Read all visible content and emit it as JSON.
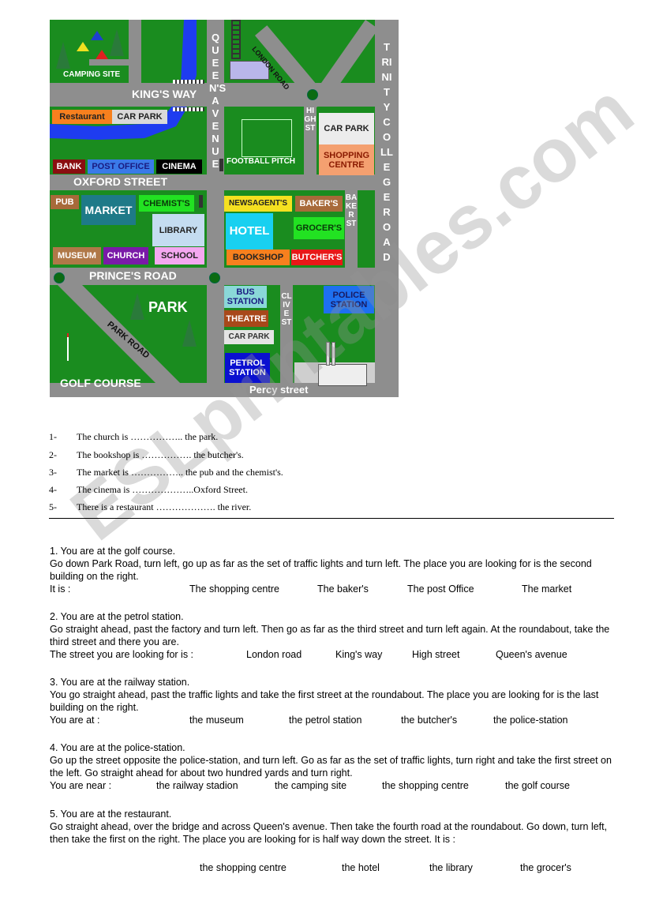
{
  "map": {
    "roads": {
      "kings_way": "KING'S WAY",
      "oxford_street": "OXFORD STREET",
      "princes_road": "PRINCE'S ROAD",
      "percy_street": "Percy street",
      "queens_avenue": "QUEEN'S AVENUE",
      "trinity_college_road": "TRINITY COLLEGE ROAD",
      "high_st": "HIGH ST",
      "baker_st": "BAKER ST",
      "clive_st": "CLIVE ST",
      "london_road": "LONDON ROAD",
      "park_road": "PARK ROAD"
    },
    "places": {
      "camping_site": "CAMPING SITE",
      "restaurant": "Restaurant",
      "car_park_1": "CAR PARK",
      "bank": "BANK",
      "post_office": "POST OFFICE",
      "cinema": "CINEMA",
      "football_pitch": "FOOTBALL PITCH",
      "car_park_2": "CAR PARK",
      "shopping_centre": "SHOPPING CENTRE",
      "pub": "PUB",
      "market": "MARKET",
      "chemists": "CHEMIST'S",
      "library": "LIBRARY",
      "museum": "MUSEUM",
      "church": "CHURCH",
      "school": "SCHOOL",
      "newsagents": "NEWSAGENT'S",
      "bakers": "BAKER'S",
      "hotel": "HOTEL",
      "grocers": "GROCER'S",
      "bookshop": "BOOKSHOP",
      "butchers": "BUTCHER'S",
      "park": "PARK",
      "golf_course": "GOLF COURSE",
      "bus_station": "BUS STATION",
      "theatre": "THEATRE",
      "car_park_3": "CAR PARK",
      "petrol_station": "PETROL STATION",
      "police_station": "POLICE STATION"
    },
    "colors": {
      "grass": "#1a8c1f",
      "road": "#8e8e8e",
      "river": "#1e3cf0"
    }
  },
  "fill_in": [
    {
      "num": "1-",
      "text": "The church is …………….. the park."
    },
    {
      "num": "2-",
      "text": "The bookshop is ……………. the butcher's."
    },
    {
      "num": "3-",
      "text": "The market is …………….. the pub and the chemist's."
    },
    {
      "num": "4-",
      "text": "The cinema is ………………..Oxford Street."
    },
    {
      "num": "5-",
      "text": "There is a restaurant ………………. the river."
    }
  ],
  "questions": [
    {
      "title": "1. You are at the golf course.",
      "body": "Go down Park Road, turn left, go up as far as the set of traffic lights and turn left. The place you are looking for is the second building on the right.",
      "prompt": "It is :",
      "options": [
        "The shopping centre",
        "The baker's",
        "The post Office",
        "The market"
      ]
    },
    {
      "title": "2. You are at the petrol station.",
      "body": "Go straight ahead, past the factory and turn left. Then go as far as the third street and turn left again. At the roundabout, take the third street and there you are.",
      "prompt": "The street you are looking for is :",
      "options": [
        "London road",
        "King's way",
        "High street",
        "Queen's avenue"
      ]
    },
    {
      "title": "3. You are at the railway station.",
      "body": "You go straight ahead, past the traffic lights and take the first street at the roundabout. The place you are looking for is the last building on the right.",
      "prompt": "You are at :",
      "options": [
        "the museum",
        "the petrol station",
        "the butcher's",
        "the police-station"
      ]
    },
    {
      "title": "4. You are at the police-station.",
      "body": "Go up the street opposite the police-station, and turn left. Go as far as the set of traffic lights, turn right and take the first street on the left. Go straight ahead for about two hundred yards and turn right.",
      "prompt": "You are near :",
      "options": [
        "the railway stadion",
        "the camping site",
        "the shopping centre",
        "the golf course"
      ]
    },
    {
      "title": "5. You are at the restaurant.",
      "body": "Go straight ahead, over the bridge and across Queen's avenue. Then take the fourth road at the roundabout. Go down, turn left, then take the first on the right. The place you are looking for is half way down the street. It is :",
      "prompt": "",
      "options": [
        "the shopping centre",
        "the hotel",
        "the library",
        "the grocer's"
      ]
    }
  ],
  "watermark": "ESLprintables.com"
}
